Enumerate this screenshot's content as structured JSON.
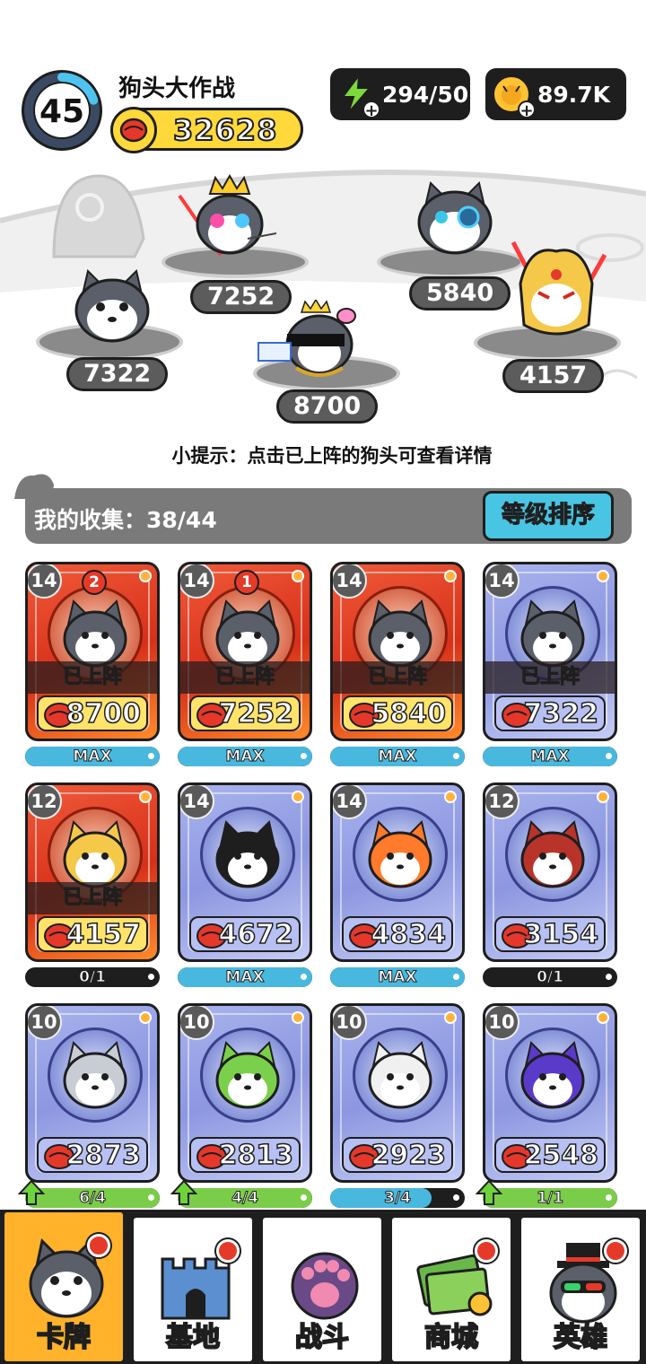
{
  "header": {
    "level": "45",
    "level_progress": 0.2,
    "title": "狗头大作战",
    "total_power": "32628",
    "energy": "294/50",
    "coins": "89.7K"
  },
  "arena": {
    "slots": [
      {
        "power": "7322",
        "skin": "plain"
      },
      {
        "power": "7252",
        "skin": "crown-laser"
      },
      {
        "power": "8700",
        "skin": "sunglasses-bow"
      },
      {
        "power": "5840",
        "skin": "cyber-eye"
      },
      {
        "power": "4157",
        "skin": "golden-helmet"
      }
    ]
  },
  "tip": "小提示：点击已上阵的狗头可查看详情",
  "collection": {
    "label": "我的收集：38/44",
    "sort_button": "等级排序"
  },
  "cards": [
    {
      "level": "14",
      "rank": "2",
      "deployed": "已上阵",
      "power": "8700",
      "theme": "red",
      "skin": "sunglasses-bow",
      "progress_text": "MAX",
      "progress": 1,
      "progress_color": "blue",
      "upgradable": false
    },
    {
      "level": "14",
      "rank": "1",
      "deployed": "已上阵",
      "power": "7252",
      "theme": "red",
      "skin": "crown-laser",
      "progress_text": "MAX",
      "progress": 1,
      "progress_color": "blue",
      "upgradable": false
    },
    {
      "level": "14",
      "rank": "",
      "deployed": "已上阵",
      "power": "5840",
      "theme": "red",
      "skin": "cyber-eye",
      "progress_text": "MAX",
      "progress": 1,
      "progress_color": "blue",
      "upgradable": false
    },
    {
      "level": "14",
      "rank": "",
      "deployed": "已上阵",
      "power": "7322",
      "theme": "purple",
      "skin": "plain",
      "progress_text": "MAX",
      "progress": 1,
      "progress_color": "blue",
      "upgradable": false
    },
    {
      "level": "12",
      "rank": "",
      "deployed": "已上阵",
      "power": "4157",
      "theme": "red",
      "skin": "golden-helmet",
      "progress_text": "0/1",
      "progress": 0,
      "progress_color": "blue",
      "upgradable": false
    },
    {
      "level": "14",
      "rank": "",
      "deployed": "",
      "power": "4672",
      "theme": "purple",
      "skin": "flame-bomb",
      "progress_text": "MAX",
      "progress": 1,
      "progress_color": "blue",
      "upgradable": false
    },
    {
      "level": "14",
      "rank": "",
      "deployed": "",
      "power": "4834",
      "theme": "purple",
      "skin": "fire-ice",
      "progress_text": "MAX",
      "progress": 1,
      "progress_color": "blue",
      "upgradable": false
    },
    {
      "level": "12",
      "rank": "",
      "deployed": "",
      "power": "3154",
      "theme": "purple",
      "skin": "soldier",
      "progress_text": "0/1",
      "progress": 0,
      "progress_color": "blue",
      "upgradable": false
    },
    {
      "level": "10",
      "rank": "",
      "deployed": "",
      "power": "2873",
      "theme": "purple",
      "skin": "astronaut",
      "progress_text": "6/4",
      "progress": 1,
      "progress_color": "green",
      "upgradable": true
    },
    {
      "level": "10",
      "rank": "",
      "deployed": "",
      "power": "2813",
      "theme": "purple",
      "skin": "dino-hood",
      "progress_text": "4/4",
      "progress": 1,
      "progress_color": "green",
      "upgradable": true
    },
    {
      "level": "10",
      "rank": "",
      "deployed": "",
      "power": "2923",
      "theme": "purple",
      "skin": "laser-eyes",
      "progress_text": "3/4",
      "progress": 0.75,
      "progress_color": "blue",
      "upgradable": false
    },
    {
      "level": "10",
      "rank": "",
      "deployed": "",
      "power": "2548",
      "theme": "purple",
      "skin": "blur",
      "progress_text": "1/1",
      "progress": 1,
      "progress_color": "green",
      "upgradable": true
    }
  ],
  "nav": {
    "tabs": [
      {
        "label": "卡牌",
        "icon": "dog-card-icon",
        "active": true
      },
      {
        "label": "基地",
        "icon": "castle-icon",
        "active": false
      },
      {
        "label": "战斗",
        "icon": "paw-icon",
        "active": false
      },
      {
        "label": "商城",
        "icon": "money-icon",
        "active": false
      },
      {
        "label": "英雄",
        "icon": "hero-dog-icon",
        "active": false
      }
    ]
  },
  "colors": {
    "accent_yellow": "#ffd93a",
    "accent_blue": "#48c5e3",
    "active_tab": "#ffb22a",
    "badge_red": "#e53a2a",
    "card_red": "#d63019",
    "card_purple": "#8c97e0"
  }
}
